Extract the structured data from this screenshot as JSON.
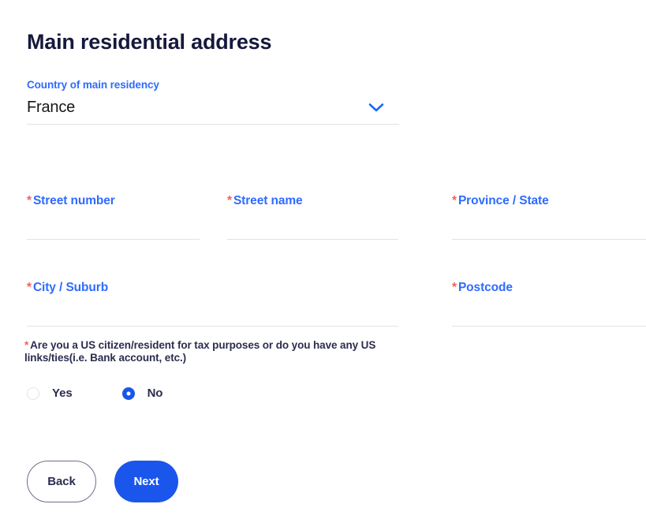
{
  "page": {
    "title": "Main residential address",
    "background_color": "#ffffff",
    "accent_color": "#2f6bff",
    "button_color": "#1a56eb",
    "required_color": "#ff5b5b",
    "heading_color": "#16193b"
  },
  "country": {
    "label": "Country of main residency",
    "value": "France",
    "placeholder": "",
    "chevron_icon": "chevron-down-icon"
  },
  "fields": {
    "street_number": {
      "label": "Street number",
      "required_marker": "*",
      "value": "",
      "placeholder": ""
    },
    "street_name": {
      "label": "Street name",
      "required_marker": "*",
      "value": "",
      "placeholder": ""
    },
    "province": {
      "label": "Province / State",
      "required_marker": "*",
      "value": "",
      "placeholder": ""
    },
    "city": {
      "label": "City / Suburb",
      "required_marker": "*",
      "value": "",
      "placeholder": ""
    },
    "postcode": {
      "label": "Postcode",
      "required_marker": "*",
      "value": "",
      "placeholder": ""
    }
  },
  "us_question": {
    "required_marker": "*",
    "text": "Are you a US citizen/resident for tax purposes or do you have any US links/ties(i.e. Bank account, etc.)",
    "options": [
      {
        "label": "Yes",
        "selected": false
      },
      {
        "label": "No",
        "selected": true
      }
    ]
  },
  "buttons": {
    "back": "Back",
    "next": "Next"
  }
}
